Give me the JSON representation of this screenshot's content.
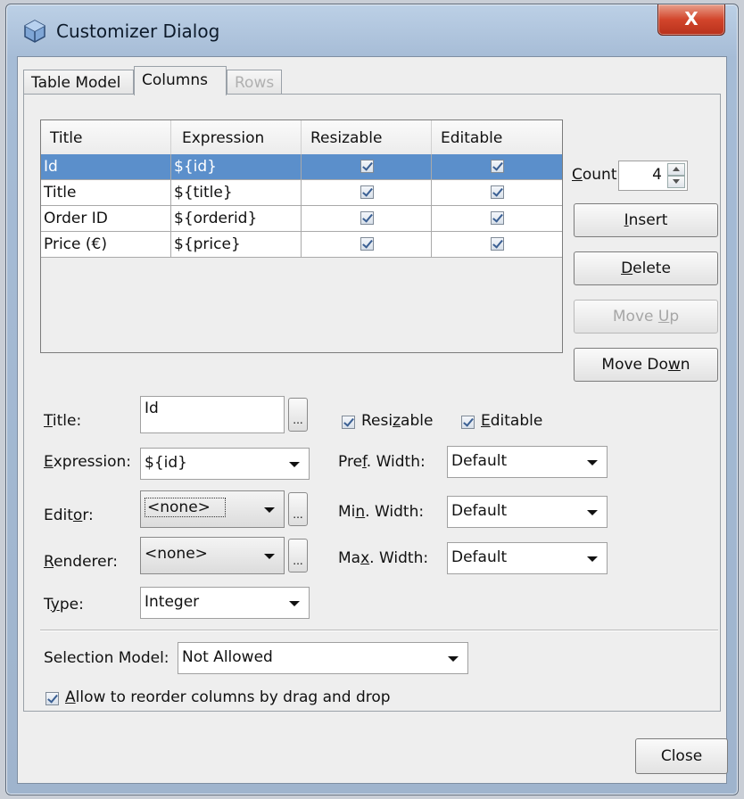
{
  "window": {
    "title": "Customizer Dialog",
    "close_label": "X"
  },
  "tabs": [
    {
      "label": "Table Model",
      "state": "normal"
    },
    {
      "label": "Columns",
      "state": "active"
    },
    {
      "label": "Rows",
      "state": "disabled"
    }
  ],
  "table": {
    "headers": [
      "Title",
      "Expression",
      "Resizable",
      "Editable"
    ],
    "rows": [
      {
        "title": "Id",
        "expression": "${id}",
        "resizable": true,
        "editable": true,
        "selected": true
      },
      {
        "title": "Title",
        "expression": "${title}",
        "resizable": true,
        "editable": true,
        "selected": false
      },
      {
        "title": "Order ID",
        "expression": "${orderid}",
        "resizable": true,
        "editable": true,
        "selected": false
      },
      {
        "title": "Price (€)",
        "expression": "${price}",
        "resizable": true,
        "editable": true,
        "selected": false
      }
    ]
  },
  "count": {
    "label": "Count:",
    "value": "4"
  },
  "buttons": {
    "insert": "Insert",
    "delete": "Delete",
    "move_up": "Move Up",
    "move_down": "Move Down",
    "close": "Close"
  },
  "form": {
    "title_label": "Title:",
    "title_value": "Id",
    "expression_label": "Expression:",
    "expression_value": "${id}",
    "editor_label": "Editor:",
    "editor_value": "<none>",
    "renderer_label": "Renderer:",
    "renderer_value": "<none>",
    "type_label": "Type:",
    "type_value": "Integer",
    "resizable_label": "Resizable",
    "editable_label": "Editable",
    "pref_width_label": "Pref. Width:",
    "pref_width_value": "Default",
    "min_width_label": "Min. Width:",
    "min_width_value": "Default",
    "max_width_label": "Max. Width:",
    "max_width_value": "Default",
    "browse_label": "..."
  },
  "selection_model": {
    "label": "Selection Model:",
    "value": "Not Allowed"
  },
  "reorder": {
    "label": "Allow to reorder columns by drag and drop",
    "checked": true
  },
  "colors": {
    "selection": "#5b8fcb",
    "close_button": "#d2452b",
    "title_bar": "#bcd0e6"
  }
}
